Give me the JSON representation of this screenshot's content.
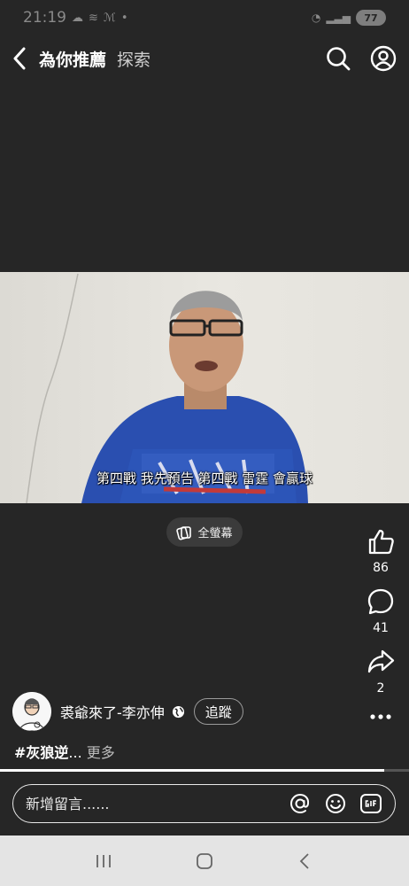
{
  "status_bar": {
    "time": "21:19",
    "battery": "77"
  },
  "header": {
    "title": "為你推薦",
    "explore_tab": "探索"
  },
  "video": {
    "subtitle": "第四戰 我先預告 第四戰 雷霆 會贏球",
    "fullscreen_label": "全螢幕"
  },
  "actions": {
    "likes": "86",
    "comments": "41",
    "shares": "2"
  },
  "author": {
    "name": "裘爺來了-李亦伸",
    "follow_label": "追蹤"
  },
  "caption": {
    "hashtag": "#灰狼逆",
    "ellipsis": "...",
    "more_label": "更多"
  },
  "playback": {
    "progress": 0.94
  },
  "comment_input": {
    "placeholder": "新增留言......"
  }
}
